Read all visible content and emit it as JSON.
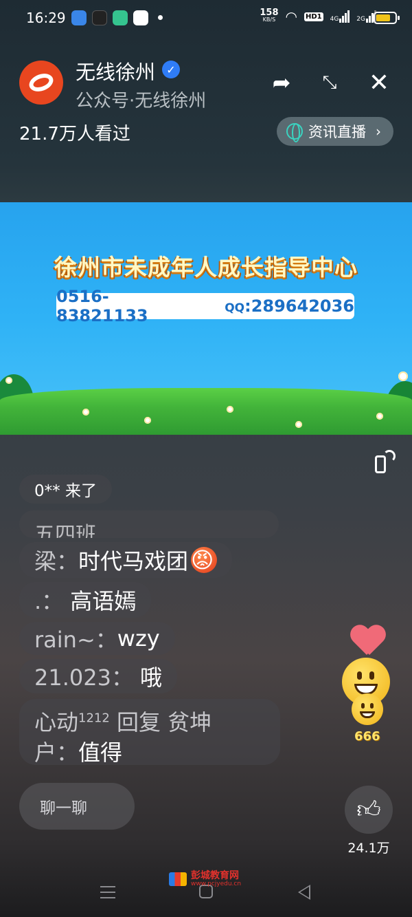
{
  "status_bar": {
    "time": "16:29",
    "net_speed_value": "158",
    "net_speed_unit": "KB/S",
    "hd_label": "HD1",
    "sim1": "4G",
    "sim2": "2G"
  },
  "header": {
    "account_name": "无线徐州",
    "subtitle": "公众号·无线徐州",
    "viewers": "21.7万人看过",
    "news_live_label": "资讯直播",
    "logo_color": "#e8461f"
  },
  "video": {
    "banner_title": "徐州市未成年人成长指导中心",
    "phone": "0516-83821133",
    "qq_label": "QQ",
    "qq_number": ":289642036"
  },
  "comments": {
    "join_notice": "0** 来了",
    "partial_text": "五四班",
    "items": [
      {
        "name": "梁：",
        "text": "时代马戏团"
      },
      {
        "name": ".：",
        "text": "高语嫣"
      },
      {
        "name": "rain~：",
        "text": "wzy"
      },
      {
        "name": "21.023：",
        "text": "哦"
      }
    ],
    "reply": {
      "name_prefix": "心动",
      "name_sup": "1212",
      "reply_word": " 回复 贫坤",
      "name_line2": "户：",
      "text": "值得"
    }
  },
  "reactions": {
    "badge_666": "666"
  },
  "bottom": {
    "chat_placeholder": "聊一聊",
    "like_count": "24.1万"
  },
  "watermark": {
    "name": "彭城教育网",
    "url": "www.pcjyedu.cn"
  }
}
